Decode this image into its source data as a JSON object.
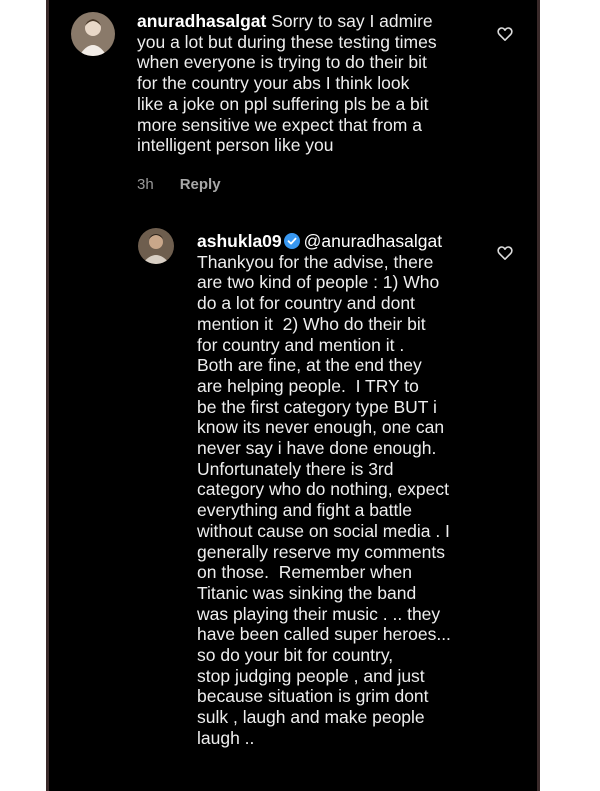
{
  "comments": [
    {
      "username": "anuradhasalgat",
      "text": " Sorry to say I admire\nyou a lot but during these testing times\nwhen everyone is trying to do their bit\nfor the country your abs I think look\nlike a joke on ppl suffering pls be a bit\nmore sensitive we expect that from a\nintelligent person like you",
      "time": "3h",
      "reply_label": "Reply",
      "avatar_icon": "profile-photo-icon",
      "like_icon": "heart-icon"
    },
    {
      "username": "ashukla09",
      "verified_icon": "verified-badge-icon",
      "mention": "@anuradhasalgat",
      "text": "Thankyou for the advise, there\nare two kind of people : 1) Who\ndo a lot for country and dont\nmention it  2) Who do their bit\nfor country and mention it .\nBoth are fine, at the end they\nare helping people.  I TRY to\nbe the first category type BUT i\nknow its never enough, one can\nnever say i have done enough.\nUnfortunately there is 3rd\ncategory who do nothing, expect\neverything and fight a battle\nwithout cause on social media . I\ngenerally reserve my comments\non those.  Remember when\nTitanic was sinking the band\nwas playing their music . .. they\nhave been called super heroes...\nso do your bit for country,\nstop judging people , and just\nbecause situation is grim dont\nsulk , laugh and make people\nlaugh ..",
      "avatar_icon": "profile-photo-icon",
      "like_icon": "heart-icon"
    }
  ],
  "colors": {
    "background": "#000000",
    "text": "#eeeeee",
    "meta": "#9a9a9a",
    "verified": "#3897f0"
  }
}
